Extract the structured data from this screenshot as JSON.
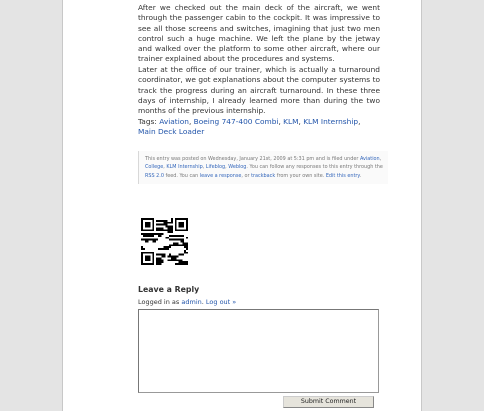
{
  "post": {
    "paragraph1": "After we checked out the main deck of the aircraft, we went through the passenger cabin to the cockpit. It was impressive to see all those screens and switches, imagining that just two men control such a huge machine. We left the plane by the jetway and walked over the platform to some other aircraft, where our trainer explained about the procedures and systems.",
    "paragraph2": "Later at the office of our trainer, which is actually a turnaround coordinator, we got explanations about the computer systems to track the progress during an aircraft turnaround. In these three days of internship, I already learned more than during the two months of the previous internship."
  },
  "tags": {
    "label": "Tags:",
    "items": [
      "Aviation",
      "Boeing 747-400 Combi",
      "KLM",
      "KLM Internship",
      "Main Deck Loader"
    ]
  },
  "meta": {
    "t1": "This entry was posted on Wednesday, January 21st, 2009 at 5:31 pm and is filed under",
    "categories": [
      "Aviation",
      "College",
      "KLM Internship",
      "Lifeblog",
      "Weblog"
    ],
    "t2": ". You can follow any responses to this entry through the",
    "rss": "RSS 2.0",
    "t3": "feed. You can",
    "leave_response": "leave a response",
    "t4": ", or",
    "trackback": "trackback",
    "t5": "from your own site.",
    "edit": "Edit this entry",
    "t6": "."
  },
  "reply": {
    "title": "Leave a Reply",
    "logged_prefix": "Logged in as",
    "user": "admin",
    "logout": "Log out »",
    "comment_value": "",
    "submit_label": "Submit Comment"
  },
  "icons": {
    "qr": "qr-code-icon"
  }
}
